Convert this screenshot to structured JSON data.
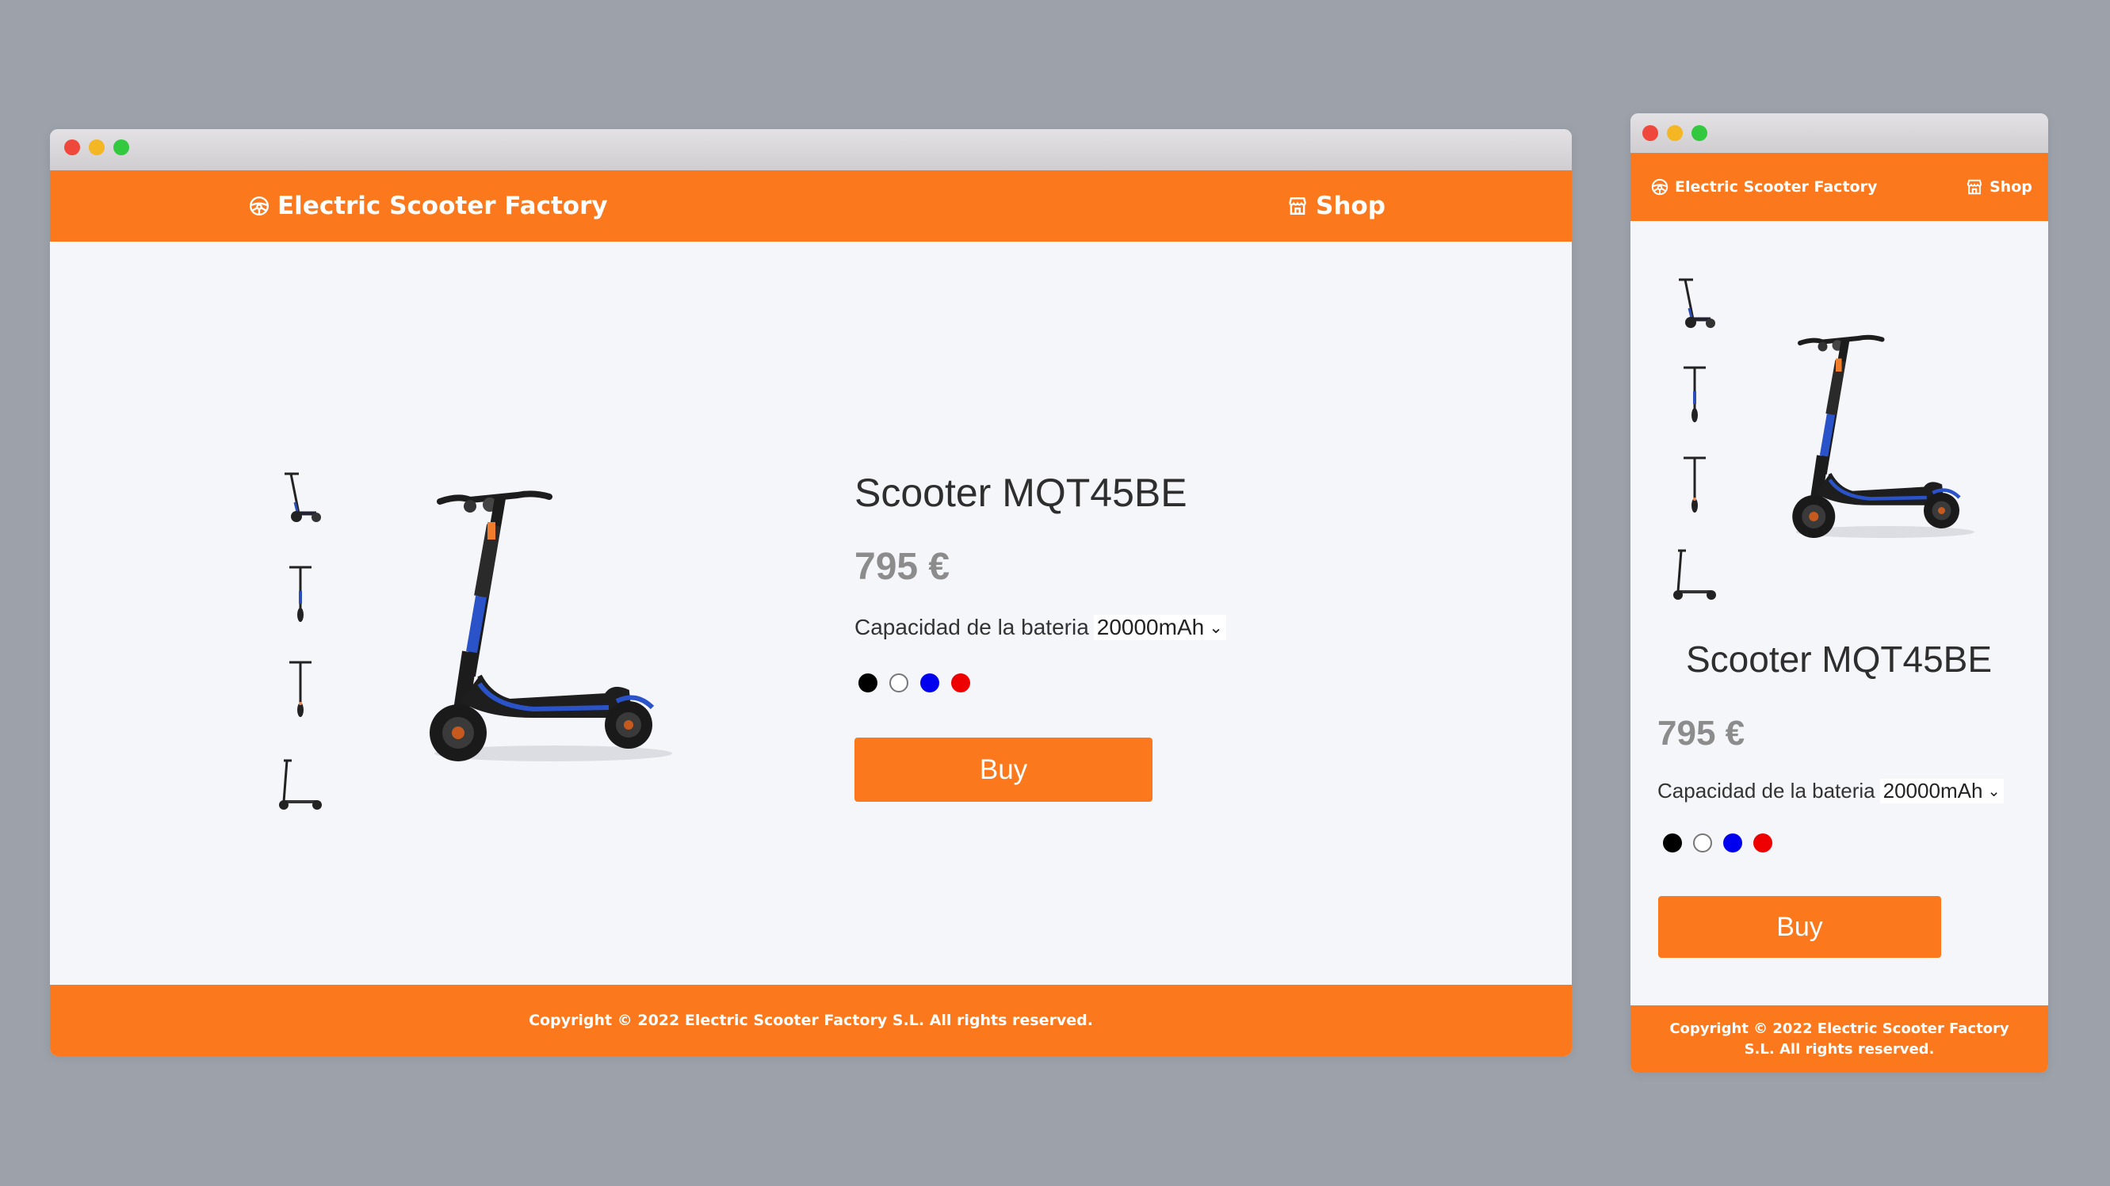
{
  "brand": {
    "name": "Electric Scooter Factory",
    "icon": "steering-wheel-icon"
  },
  "nav": {
    "shop_label": "Shop",
    "shop_icon": "store-icon"
  },
  "product": {
    "title": "Scooter MQT45BE",
    "price": "795 €",
    "battery_label": "Capacidad de la bateria",
    "battery_selected": "20000mAh",
    "colors": [
      "#000000",
      "#ffffff",
      "#0000ee",
      "#ee0000"
    ],
    "buy_label": "Buy",
    "thumbnails": [
      "scooter-side-view",
      "scooter-front-view",
      "scooter-rear-view",
      "scooter-folded-view"
    ]
  },
  "footer": {
    "copyright": "Copyright © 2022 Electric Scooter Factory S.L. All rights reserved."
  },
  "theme": {
    "accent": "#fb791c",
    "background": "#9da1aa",
    "page": "#f5f6fa"
  }
}
